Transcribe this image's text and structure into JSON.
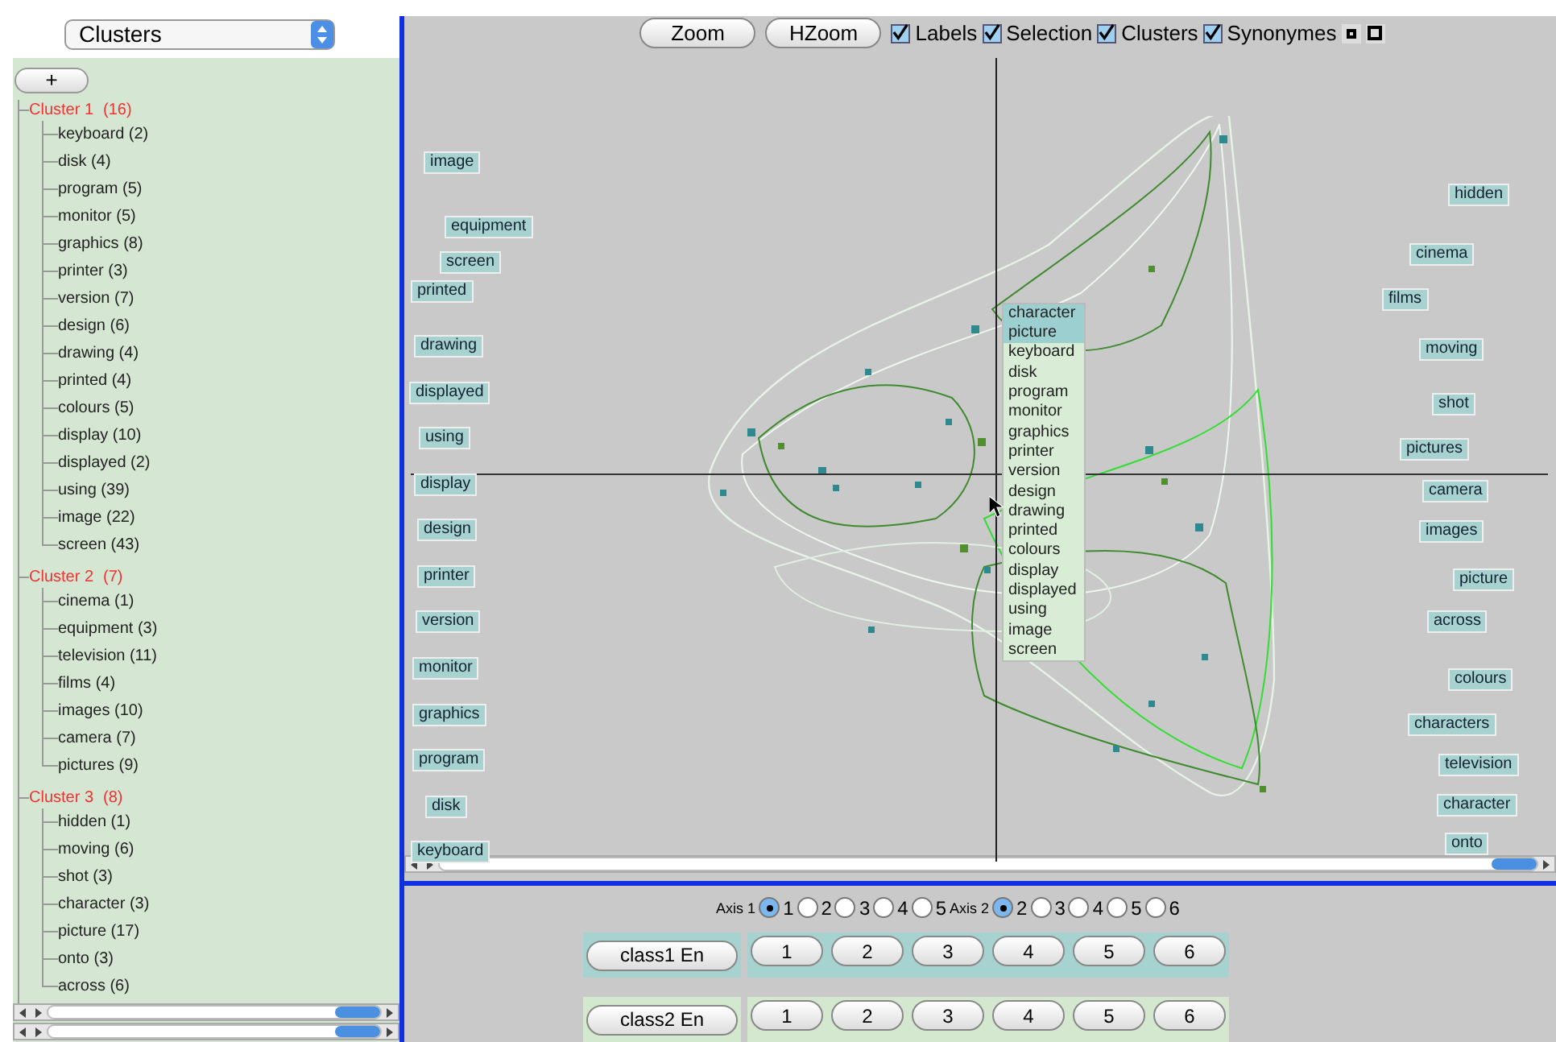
{
  "cluster_select": {
    "value": "Clusters"
  },
  "add_button": "+",
  "clusters": [
    {
      "label": "Cluster 1",
      "count": "(16)",
      "children": [
        {
          "label": "keyboard (2)"
        },
        {
          "label": "disk (4)"
        },
        {
          "label": "program (5)"
        },
        {
          "label": "monitor (5)"
        },
        {
          "label": "graphics (8)"
        },
        {
          "label": "printer (3)"
        },
        {
          "label": "version (7)"
        },
        {
          "label": "design (6)"
        },
        {
          "label": "drawing (4)"
        },
        {
          "label": "printed (4)"
        },
        {
          "label": "colours (5)"
        },
        {
          "label": "display (10)"
        },
        {
          "label": "displayed (2)"
        },
        {
          "label": "using (39)"
        },
        {
          "label": "image (22)"
        },
        {
          "label": "screen (43)"
        }
      ]
    },
    {
      "label": "Cluster 2",
      "count": "(7)",
      "children": [
        {
          "label": "cinema (1)"
        },
        {
          "label": "equipment (3)"
        },
        {
          "label": "television (11)"
        },
        {
          "label": "films (4)"
        },
        {
          "label": "images (10)"
        },
        {
          "label": "camera (7)"
        },
        {
          "label": "pictures (9)"
        }
      ]
    },
    {
      "label": "Cluster 3",
      "count": "(8)",
      "children": [
        {
          "label": "hidden (1)"
        },
        {
          "label": "moving (6)"
        },
        {
          "label": "shot (3)"
        },
        {
          "label": "character (3)"
        },
        {
          "label": "picture (17)"
        },
        {
          "label": "onto (3)"
        },
        {
          "label": "across (6)"
        }
      ]
    }
  ],
  "toolbar": {
    "buttons": [
      "Zoom",
      "HZoom"
    ],
    "checkboxes": [
      {
        "label": "Labels",
        "checked": true
      },
      {
        "label": "Selection",
        "checked": true
      },
      {
        "label": "Clusters",
        "checked": true
      },
      {
        "label": "Synonymes",
        "checked": true
      }
    ]
  },
  "plot": {
    "left_labels": [
      "image",
      "equipment",
      "screen",
      "printed",
      "drawing",
      "displayed",
      "using",
      "display",
      "design",
      "printer",
      "version",
      "monitor",
      "graphics",
      "program",
      "disk",
      "keyboard"
    ],
    "right_labels": [
      "hidden",
      "cinema",
      "films",
      "moving",
      "shot",
      "pictures",
      "camera",
      "images",
      "picture",
      "across",
      "colours",
      "characters",
      "television",
      "character",
      "onto"
    ],
    "popup": [
      {
        "label": "character",
        "selected": true
      },
      {
        "label": "picture",
        "selected": true
      },
      {
        "label": "keyboard",
        "selected": false
      },
      {
        "label": "disk",
        "selected": false
      },
      {
        "label": "program",
        "selected": false
      },
      {
        "label": "monitor",
        "selected": false
      },
      {
        "label": "graphics",
        "selected": false
      },
      {
        "label": "printer",
        "selected": false
      },
      {
        "label": "version",
        "selected": false
      },
      {
        "label": "design",
        "selected": false
      },
      {
        "label": "drawing",
        "selected": false
      },
      {
        "label": "printed",
        "selected": false
      },
      {
        "label": "colours",
        "selected": false
      },
      {
        "label": "display",
        "selected": false
      },
      {
        "label": "displayed",
        "selected": false
      },
      {
        "label": "using",
        "selected": false
      },
      {
        "label": "image",
        "selected": false
      },
      {
        "label": "screen",
        "selected": false
      }
    ]
  },
  "axes": [
    {
      "label": "Axis 1",
      "options": [
        {
          "label": "1",
          "selected": true
        },
        {
          "label": "2",
          "selected": false
        },
        {
          "label": "3",
          "selected": false
        },
        {
          "label": "4",
          "selected": false
        },
        {
          "label": "5",
          "selected": false
        }
      ]
    },
    {
      "label": "Axis 2",
      "options": [
        {
          "label": "2",
          "selected": true
        },
        {
          "label": "3",
          "selected": false
        },
        {
          "label": "4",
          "selected": false
        },
        {
          "label": "5",
          "selected": false
        },
        {
          "label": "6",
          "selected": false
        }
      ]
    }
  ],
  "class_rows": [
    {
      "label": "class1 En",
      "color": "#a6d2d0",
      "buttons": [
        "1",
        "2",
        "3",
        "4",
        "5",
        "6"
      ]
    },
    {
      "label": "class2 En",
      "color": "#d4e8cf",
      "buttons": [
        "1",
        "2",
        "3",
        "4",
        "5",
        "6"
      ]
    }
  ]
}
